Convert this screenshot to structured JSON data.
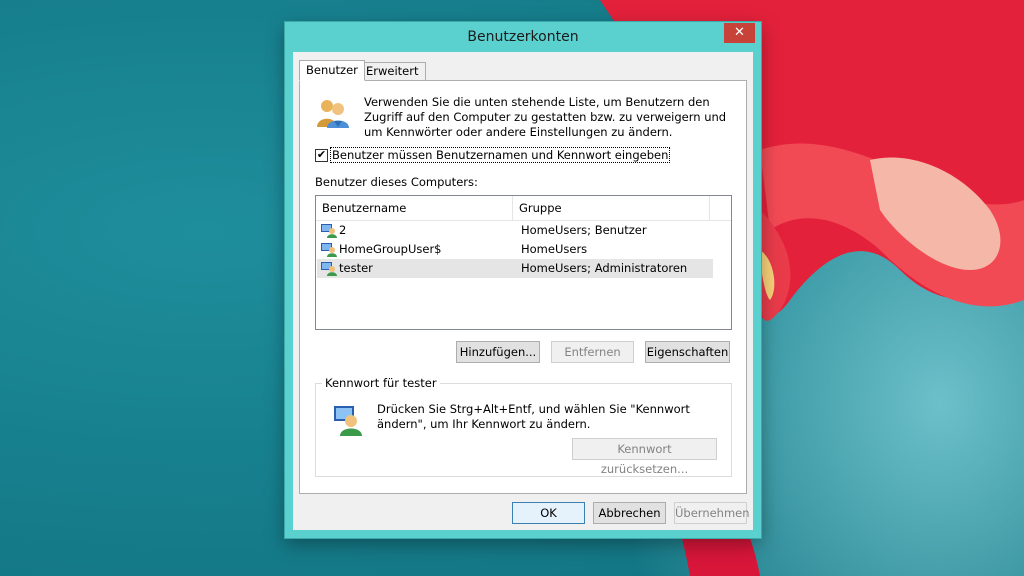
{
  "window": {
    "title": "Benutzerkonten",
    "close_glyph": "✕"
  },
  "tabs": [
    {
      "label": "Benutzer",
      "active": true
    },
    {
      "label": "Erweitert",
      "active": false
    }
  ],
  "intro_text": "Verwenden Sie die unten stehende Liste, um Benutzern den Zugriff auf den Computer zu gestatten bzw. zu verweigern und um Kennwörter oder andere Einstellungen zu ändern.",
  "require_login": {
    "label": "Benutzer müssen Benutzernamen und Kennwort eingeben",
    "checked": true,
    "check_glyph": "✔"
  },
  "users_list": {
    "label": "Benutzer dieses Computers:",
    "columns": [
      "Benutzername",
      "Gruppe"
    ],
    "rows": [
      {
        "name": "2",
        "group": "HomeUsers; Benutzer"
      },
      {
        "name": "HomeGroupUser$",
        "group": "HomeUsers"
      },
      {
        "name": "tester",
        "group": "HomeUsers; Administratoren",
        "selected": true
      }
    ]
  },
  "list_buttons": {
    "add": "Hinzufügen...",
    "remove": "Entfernen",
    "properties": "Eigenschaften"
  },
  "password_group": {
    "title": "Kennwort für tester",
    "text": "Drücken Sie Strg+Alt+Entf, und wählen Sie \"Kennwort ändern\", um Ihr Kennwort zu ändern.",
    "reset_button": "Kennwort zurücksetzen..."
  },
  "footer_buttons": {
    "ok": "OK",
    "cancel": "Abbrechen",
    "apply": "Übernehmen"
  },
  "icons": {
    "users": "users-icon",
    "user_row": "user-icon",
    "key_user": "user-key-icon",
    "close": "close-icon"
  },
  "colors": {
    "window_frame": "#5ad1cf",
    "close_button": "#c7433a",
    "desktop": "#17808e",
    "flower": "#e8233a"
  }
}
